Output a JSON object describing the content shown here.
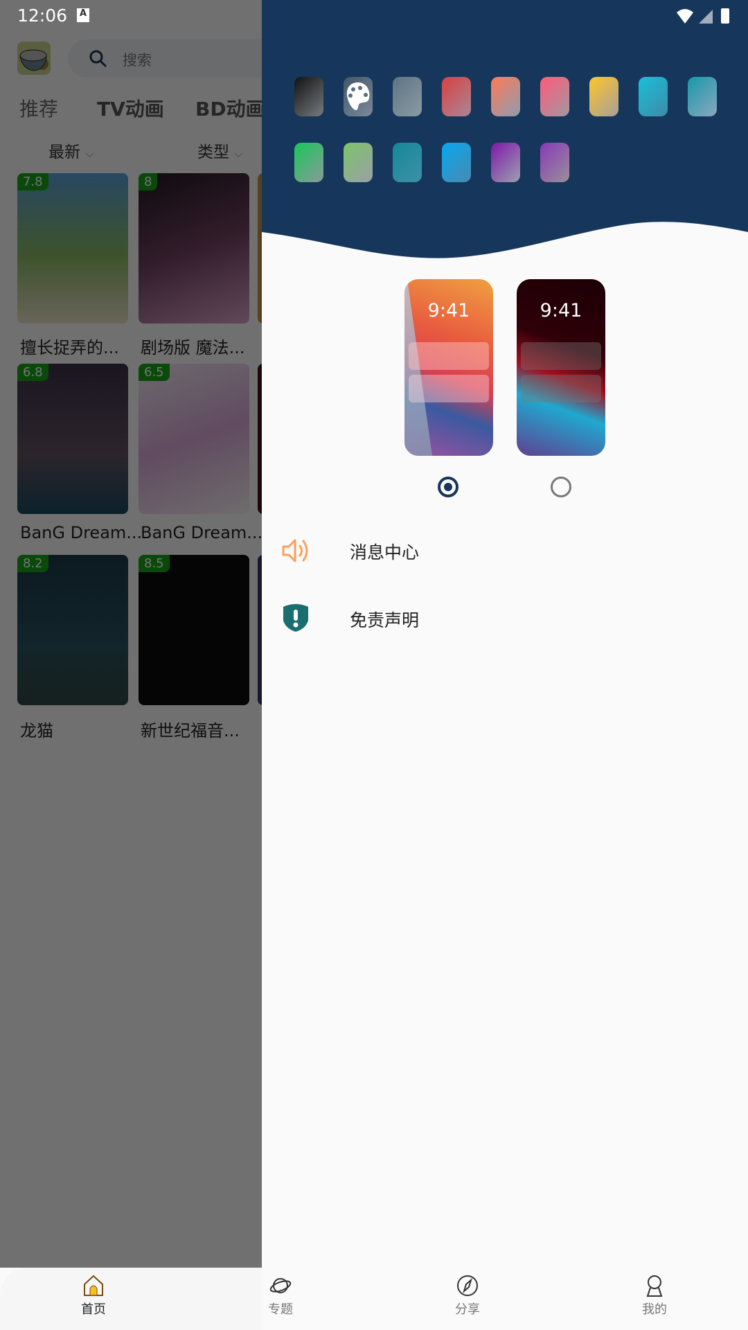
{
  "status_bar": {
    "time": "12:06",
    "indicator": "A"
  },
  "app_bar": {
    "search_placeholder": "搜索"
  },
  "tabs": [
    {
      "label": "推荐"
    },
    {
      "label": "TV动画"
    },
    {
      "label": "BD动画"
    }
  ],
  "filters": [
    {
      "label": "最新"
    },
    {
      "label": "类型"
    }
  ],
  "cards": [
    {
      "rating": "7.8",
      "title": "擅长捉弄的..."
    },
    {
      "rating": "8",
      "title": "剧场版 魔法..."
    },
    {
      "rating": "6.8",
      "title": "BanG Dream..."
    },
    {
      "rating": "6.5",
      "title": "BanG Dream..."
    },
    {
      "rating": "8.2",
      "title": "龙猫"
    },
    {
      "rating": "8.5",
      "title": "新世纪福音..."
    }
  ],
  "drawer": {
    "header_color": "#16365b",
    "swatches": [
      [
        "#111111",
        "#777b80"
      ],
      [
        "#44566a",
        "#7a8a9a"
      ],
      [
        "#5d7482",
        "#8a9ba6"
      ],
      [
        "#d84040",
        "#a88898"
      ],
      [
        "#ff7a55",
        "#8e9cb0"
      ],
      [
        "#ff5a7a",
        "#a098a0"
      ],
      [
        "#ffc52a",
        "#a6a09a"
      ],
      [
        "#18c0d8",
        "#3f8aa8"
      ],
      [
        "#1898a8",
        "#8aa8c0"
      ],
      [
        "#18c858",
        "#8a9a9a"
      ],
      [
        "#7cc468",
        "#9aa0a8"
      ],
      [
        "#148898",
        "#3f90a8"
      ],
      [
        "#05a8f0",
        "#4a8ab0"
      ],
      [
        "#8018a8",
        "#9aa0b0"
      ],
      [
        "#8838b8",
        "#9a9098"
      ]
    ],
    "palette_swatch_index": 1,
    "theme_previews": [
      {
        "time": "9:41",
        "mode": "light",
        "selected": true
      },
      {
        "time": "9:41",
        "mode": "dark",
        "selected": false
      }
    ],
    "menu": [
      {
        "label": "消息中心",
        "icon": "speaker-icon",
        "color": "#ff9f5a"
      },
      {
        "label": "免责声明",
        "icon": "shield-alert-icon",
        "color": "#1a6e6e"
      }
    ]
  },
  "bottom_nav": [
    {
      "label": "首页",
      "icon": "home-icon",
      "active": true
    },
    {
      "label": "专题",
      "icon": "planet-icon",
      "active": false
    },
    {
      "label": "分享",
      "icon": "compass-icon",
      "active": false
    },
    {
      "label": "我的",
      "icon": "user-icon",
      "active": false
    }
  ]
}
